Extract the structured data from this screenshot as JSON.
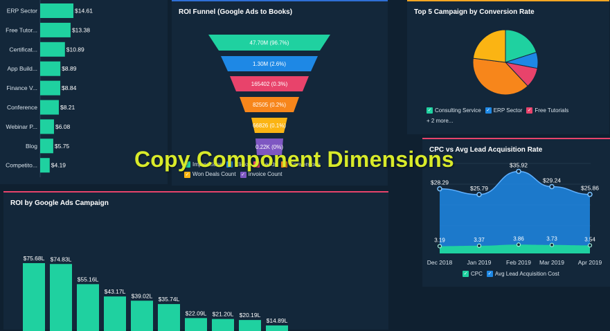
{
  "overlay_title": "Copy Component Dimensions",
  "chart_data": [
    {
      "type": "bar",
      "orientation": "horizontal",
      "title": "",
      "categories": [
        "ERP Sector",
        "Free Tutor...",
        "Certificat...",
        "App Build...",
        "Finance V...",
        "Conference",
        "Webinar P...",
        "Blog",
        "Competito..."
      ],
      "values": [
        14.61,
        13.38,
        10.89,
        8.89,
        8.84,
        8.21,
        6.08,
        5.75,
        4.19
      ],
      "value_labels": [
        "$14.61",
        "$13.38",
        "$10.89",
        "$8.89",
        "$8.84",
        "$8.21",
        "$6.08",
        "$5.75",
        "$4.19"
      ],
      "color": "#1fd1a0"
    },
    {
      "type": "funnel",
      "title": "ROI Funnel (Google Ads to Books)",
      "stages": [
        {
          "label": "47.70M (96.7%)",
          "color": "#1fd1a0"
        },
        {
          "label": "1.30M (2.6%)",
          "color": "#1e88e5"
        },
        {
          "label": "165402 (0.3%)",
          "color": "#e8436b"
        },
        {
          "label": "82505 (0.2%)",
          "color": "#f7861b"
        },
        {
          "label": "66826 (0.1%)",
          "color": "#fbb413"
        },
        {
          "label": "0.22K (0%)",
          "color": "#7e57c2"
        }
      ],
      "legend": [
        {
          "name": "Impressions",
          "color": "#1fd1a0"
        },
        {
          "name": "Clicks",
          "color": "#1e88e5"
        },
        {
          "name": "Leads",
          "color": "#e8436b"
        },
        {
          "name": "Conversions",
          "color": "#f7861b"
        },
        {
          "name": "Won Deals Count",
          "color": "#fbb413"
        },
        {
          "name": "Invoice Count",
          "color": "#7e57c2"
        }
      ]
    },
    {
      "type": "pie",
      "title": "Top 5 Campaign by Conversion Rate",
      "slices": [
        {
          "name": "Consulting Service",
          "value": 20,
          "color": "#1fd1a0"
        },
        {
          "name": "ERP Sector",
          "value": 8,
          "color": "#1e88e5"
        },
        {
          "name": "Free Tutorials",
          "value": 10,
          "color": "#e8436b"
        },
        {
          "name": "",
          "value": 39,
          "color": "#f7861b"
        },
        {
          "name": "",
          "value": 23,
          "color": "#fbb413"
        }
      ],
      "legend_more": "+ 2 more..."
    },
    {
      "type": "area",
      "title": "CPC vs Avg Lead Acquisition Rate",
      "categories": [
        "Dec 2018",
        "Jan 2019",
        "Feb 2019",
        "Mar 2019",
        "Apr 2019"
      ],
      "series": [
        {
          "name": "Avg Lead Acquisition Cost",
          "values": [
            28.29,
            25.79,
            35.92,
            29.24,
            25.86
          ],
          "labels": [
            "$28.29",
            "$25.79",
            "$35.92",
            "$29.24",
            "$25.86"
          ],
          "color": "#1e88e5"
        },
        {
          "name": "CPC",
          "values": [
            3.19,
            3.37,
            3.86,
            3.73,
            3.54
          ],
          "labels": [
            "3.19",
            "3.37",
            "3.86",
            "3.73",
            "3.54"
          ],
          "color": "#1fd1a0"
        }
      ],
      "legend": [
        {
          "name": "CPC",
          "color": "#1fd1a0"
        },
        {
          "name": "Avg Lead Acquisition Cost",
          "color": "#1e88e5"
        }
      ],
      "ylim": [
        0,
        40
      ]
    },
    {
      "type": "bar",
      "title": "ROI by Google Ads Campaign",
      "values": [
        75.68,
        74.83,
        55.16,
        43.17,
        39.02,
        35.74,
        22.09,
        21.2,
        20.19,
        14.89
      ],
      "value_labels": [
        "$75.68L",
        "$74.83L",
        "$55.16L",
        "$43.17L",
        "$39.02L",
        "$35.74L",
        "$22.09L",
        "$21.20L",
        "$20.19L",
        "$14.89L"
      ],
      "color": "#1fd1a0",
      "ylim": [
        0,
        90
      ]
    }
  ]
}
